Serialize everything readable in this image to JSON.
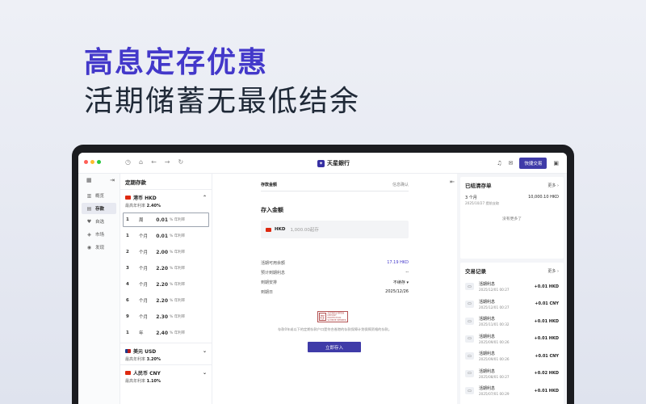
{
  "hero": {
    "title": "高息定存优惠",
    "subtitle": "活期储蓄无最低结余"
  },
  "colors": {
    "accent": "#3f3ba8",
    "hero_title": "#4338ca",
    "dot_red": "#ff5f57",
    "dot_yellow": "#febc2e",
    "dot_green": "#28c840"
  },
  "topbar": {
    "brand_name": "天星銀行",
    "quick_trade_label": "快捷交易",
    "icons": [
      "clock-icon",
      "home-icon",
      "back-arrow-icon",
      "forward-arrow-icon",
      "refresh-icon",
      "bell-icon",
      "mail-icon",
      "lock-icon"
    ]
  },
  "sidebar": {
    "items": [
      {
        "label": "概览",
        "icon": "chart-bars-icon"
      },
      {
        "label": "存款",
        "icon": "deposit-icon",
        "active": true
      },
      {
        "label": "自选",
        "icon": "heart-icon"
      },
      {
        "label": "市场",
        "icon": "market-icon"
      },
      {
        "label": "发现",
        "icon": "compass-icon"
      }
    ]
  },
  "deposits": {
    "title": "定期存款",
    "rate_suffix": "年利率",
    "hkd": {
      "name": "港币 HKD",
      "best_rate_label": "最高年利率",
      "best_rate": "2.40%",
      "terms": [
        {
          "n": "1",
          "unit": "周",
          "rate": "0.01"
        },
        {
          "n": "1",
          "unit": "个月",
          "rate": "0.01"
        },
        {
          "n": "2",
          "unit": "个月",
          "rate": "2.00"
        },
        {
          "n": "3",
          "unit": "个月",
          "rate": "2.20"
        },
        {
          "n": "4",
          "unit": "个月",
          "rate": "2.20"
        },
        {
          "n": "6",
          "unit": "个月",
          "rate": "2.20"
        },
        {
          "n": "9",
          "unit": "个月",
          "rate": "2.30"
        },
        {
          "n": "1",
          "unit": "年",
          "rate": "2.40"
        }
      ]
    },
    "usd": {
      "name": "美元 USD",
      "best_rate_label": "最高年利率",
      "best_rate": "3.20%"
    },
    "cny": {
      "name": "人民币 CNY",
      "best_rate_label": "最高年利率",
      "best_rate": "1.10%"
    }
  },
  "form": {
    "step1": "存款金额",
    "step2": "信息确认",
    "amount_label": "存入金额",
    "currency": "HKD",
    "amount_placeholder": "1,000.00起存",
    "rows": [
      {
        "label": "活期可用余额",
        "value": "17.19 HKD",
        "blue": true
      },
      {
        "label": "预计到期利息",
        "value": "--"
      },
      {
        "label": "到期安排",
        "value": "不续存"
      },
      {
        "label": "到期日",
        "value": "2025/12/26"
      }
    ],
    "dps_mark": "存",
    "dps_lines": [
      "存款保障計劃成員",
      "DEPOSIT PROTECTION",
      "SCHEME MEMBER"
    ],
    "disclaimer": "存款0年或以下的定期存款户口是符合香港的存款保障计划保障资格的存款。",
    "submit_label": "立即存入"
  },
  "matured": {
    "title": "已结清存单",
    "more": "更多",
    "item": {
      "term": "3 个月",
      "amount": "10,000.10 HKD",
      "date": "2025/10/27",
      "note": "提前支取"
    },
    "none_more": "没有更多了"
  },
  "transactions": {
    "title": "交易记录",
    "more": "更多",
    "items": [
      {
        "name": "活期利息",
        "time": "2025/12/01 00:27",
        "amount": "+0.01 HKD"
      },
      {
        "name": "活期利息",
        "time": "2025/12/01 00:27",
        "amount": "+0.01 CNY"
      },
      {
        "name": "活期利息",
        "time": "2025/11/01 00:32",
        "amount": "+0.01 HKD"
      },
      {
        "name": "活期利息",
        "time": "2025/09/01 00:26",
        "amount": "+0.01 HKD"
      },
      {
        "name": "活期利息",
        "time": "2025/09/01 00:26",
        "amount": "+0.01 CNY"
      },
      {
        "name": "活期利息",
        "time": "2025/08/01 00:27",
        "amount": "+0.02 HKD"
      },
      {
        "name": "活期利息",
        "time": "2025/07/01 00:29",
        "amount": "+0.01 HKD"
      }
    ]
  }
}
